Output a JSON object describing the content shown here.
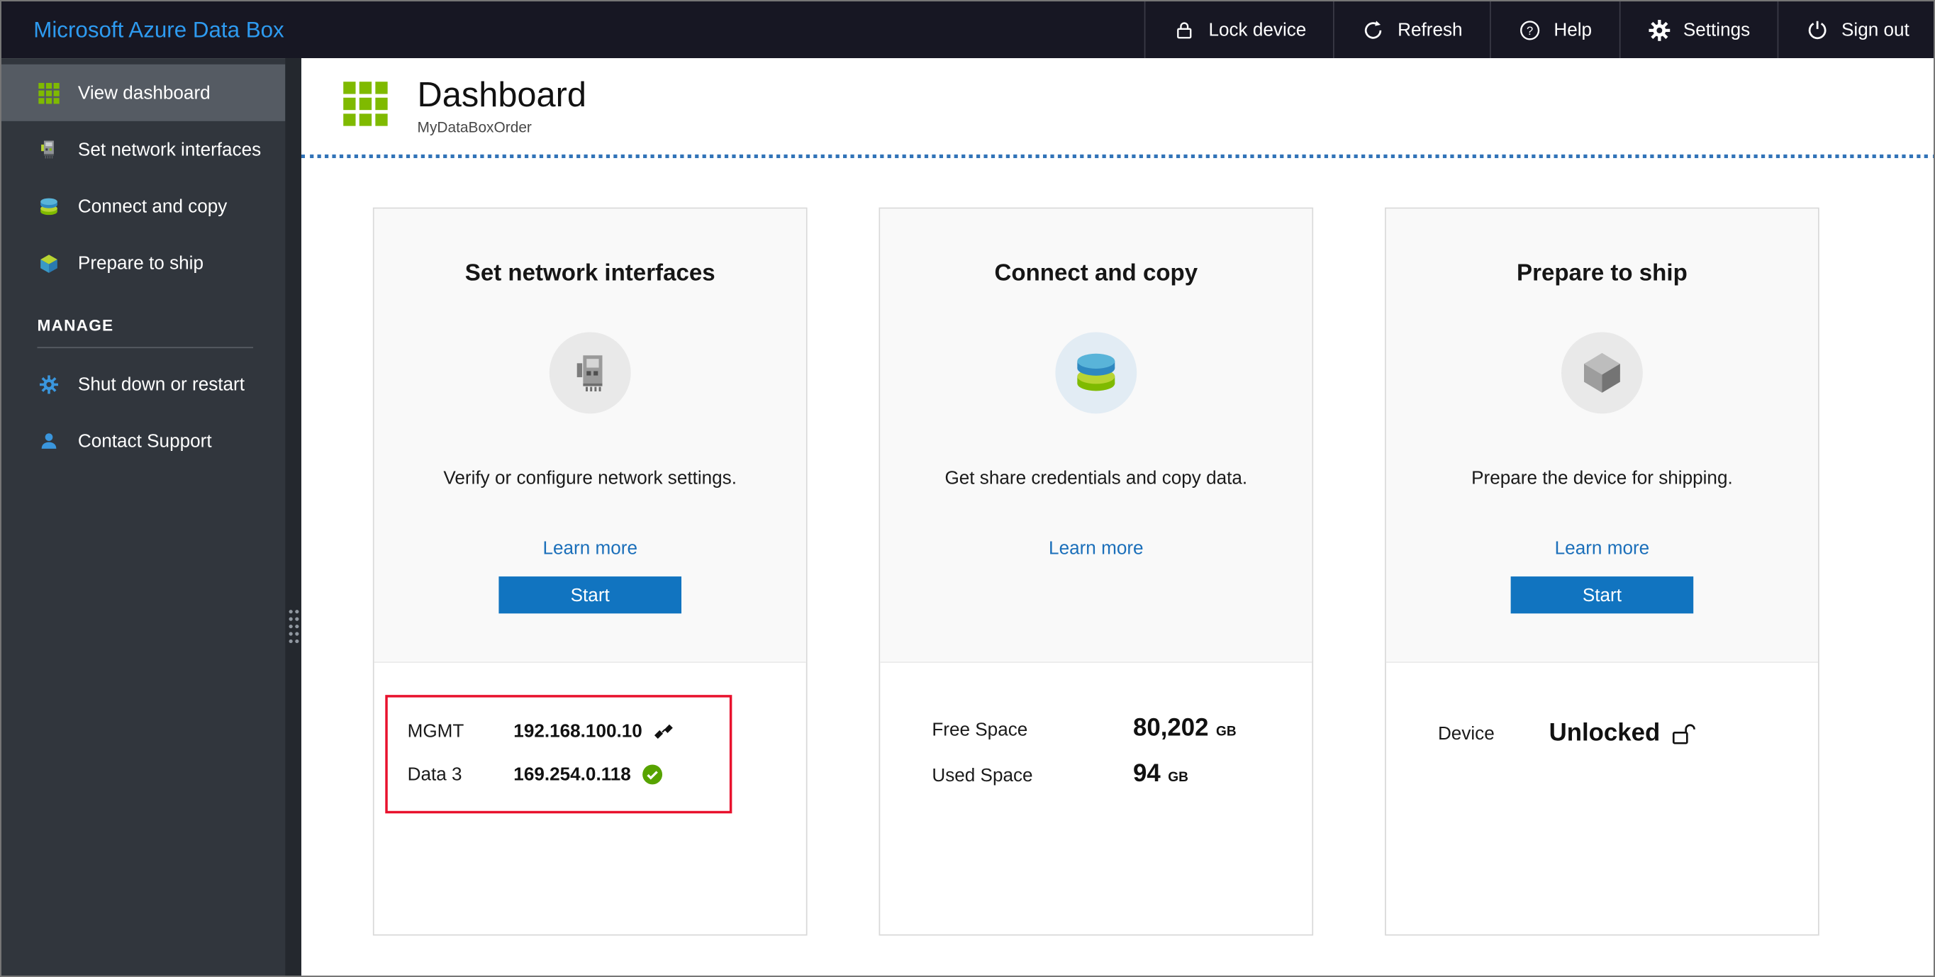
{
  "colors": {
    "brand_blue": "#2e9bf0",
    "accent_blue": "#1174c0",
    "link_blue": "#1b6fba",
    "success_green": "#57a300",
    "azure_green": "#7fba00",
    "annotation_red": "#e8112d"
  },
  "topbar": {
    "title": "Microsoft Azure Data Box",
    "actions": [
      {
        "label": "Lock device",
        "icon": "lock-icon"
      },
      {
        "label": "Refresh",
        "icon": "refresh-icon"
      },
      {
        "label": "Help",
        "icon": "help-icon"
      },
      {
        "label": "Settings",
        "icon": "gear-icon"
      },
      {
        "label": "Sign out",
        "icon": "power-icon"
      }
    ]
  },
  "sidebar": {
    "items": [
      {
        "label": "View dashboard",
        "icon": "dashboard-grid-icon",
        "selected": true
      },
      {
        "label": "Set network interfaces",
        "icon": "network-card-icon",
        "selected": false
      },
      {
        "label": "Connect and copy",
        "icon": "disks-icon",
        "selected": false
      },
      {
        "label": "Prepare to ship",
        "icon": "box-icon",
        "selected": false
      }
    ],
    "section_label": "MANAGE",
    "manage_items": [
      {
        "label": "Shut down or restart",
        "icon": "power-gear-icon"
      },
      {
        "label": "Contact Support",
        "icon": "person-icon"
      }
    ]
  },
  "header": {
    "title": "Dashboard",
    "subtitle": "MyDataBoxOrder"
  },
  "cards": [
    {
      "title": "Set network interfaces",
      "description": "Verify or configure network settings.",
      "learn_more_label": "Learn more",
      "start_label": "Start",
      "interfaces": [
        {
          "name": "MGMT",
          "ip": "192.168.100.10",
          "status_icon": "plug-icon"
        },
        {
          "name": "Data 3",
          "ip": "169.254.0.118",
          "status_icon": "check-icon"
        }
      ]
    },
    {
      "title": "Connect and copy",
      "description": "Get share credentials and copy data.",
      "learn_more_label": "Learn more",
      "stats": [
        {
          "label": "Free Space",
          "value": "80,202",
          "unit": "GB"
        },
        {
          "label": "Used Space",
          "value": "94",
          "unit": "GB"
        }
      ]
    },
    {
      "title": "Prepare to ship",
      "description": "Prepare the device for shipping.",
      "learn_more_label": "Learn more",
      "start_label": "Start",
      "device_status": {
        "label": "Device",
        "value": "Unlocked",
        "icon": "unlock-icon"
      }
    }
  ]
}
